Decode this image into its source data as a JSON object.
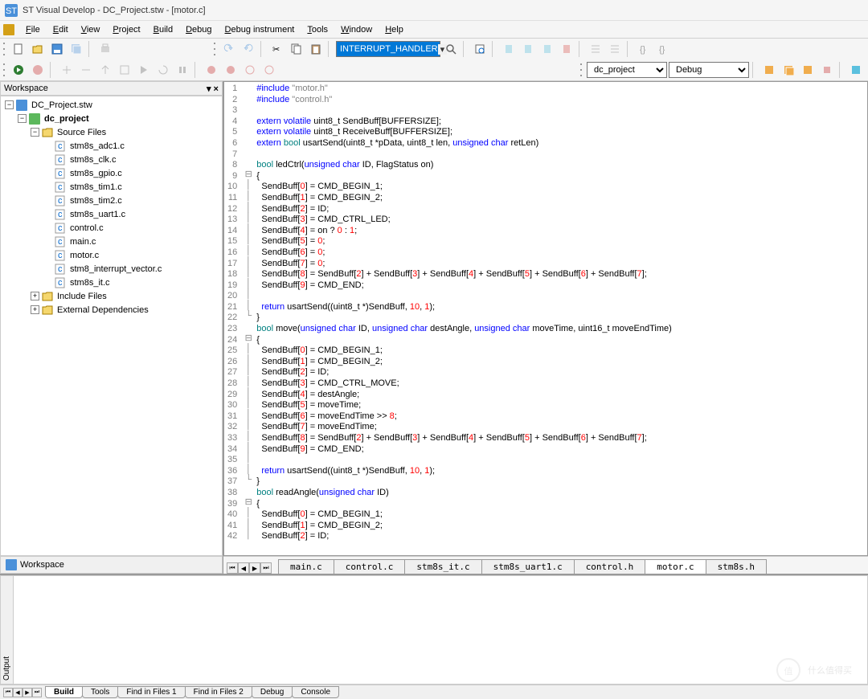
{
  "title": "ST Visual Develop - DC_Project.stw - [motor.c]",
  "menubar": [
    "File",
    "Edit",
    "View",
    "Project",
    "Build",
    "Debug",
    "Debug instrument",
    "Tools",
    "Window",
    "Help"
  ],
  "toolbar": {
    "highlight_text": "INTERRUPT_HANDLER",
    "target": "dc_project",
    "config": "Debug"
  },
  "workspace": {
    "title": "Workspace",
    "tab_label": "Workspace",
    "root": {
      "label": "DC_Project.stw",
      "icon": "workspace"
    },
    "project": {
      "label": "dc_project",
      "icon": "project"
    },
    "groups": [
      {
        "label": "Source Files",
        "expanded": true,
        "files": [
          "stm8s_adc1.c",
          "stm8s_clk.c",
          "stm8s_gpio.c",
          "stm8s_tim1.c",
          "stm8s_tim2.c",
          "stm8s_uart1.c",
          "control.c",
          "main.c",
          "motor.c",
          "stm8_interrupt_vector.c",
          "stm8s_it.c"
        ]
      },
      {
        "label": "Include Files",
        "expanded": false
      },
      {
        "label": "External Dependencies",
        "expanded": false
      }
    ]
  },
  "editor": {
    "active_tab": "motor.c",
    "tabs": [
      "main.c",
      "control.c",
      "stm8s_it.c",
      "stm8s_uart1.c",
      "control.h",
      "motor.c",
      "stm8s.h"
    ],
    "code_lines": [
      {
        "n": 1,
        "f": "",
        "t": [
          [
            "kw-blue",
            "#include "
          ],
          [
            "str",
            "\"motor.h\""
          ]
        ]
      },
      {
        "n": 2,
        "f": "",
        "t": [
          [
            "kw-blue",
            "#include "
          ],
          [
            "str",
            "\"control.h\""
          ]
        ]
      },
      {
        "n": 3,
        "f": "",
        "t": []
      },
      {
        "n": 4,
        "f": "",
        "t": [
          [
            "kw-blue",
            "extern"
          ],
          [
            "",
            " "
          ],
          [
            "kw-blue",
            "volatile"
          ],
          [
            "",
            " uint8_t SendBuff[BUFFERSIZE];"
          ]
        ]
      },
      {
        "n": 5,
        "f": "",
        "t": [
          [
            "kw-blue",
            "extern"
          ],
          [
            "",
            " "
          ],
          [
            "kw-blue",
            "volatile"
          ],
          [
            "",
            " uint8_t ReceiveBuff[BUFFERSIZE];"
          ]
        ]
      },
      {
        "n": 6,
        "f": "",
        "t": [
          [
            "kw-blue",
            "extern"
          ],
          [
            "",
            " "
          ],
          [
            "kw-green",
            "bool"
          ],
          [
            "",
            " usartSend(uint8_t *pData, uint8_t len, "
          ],
          [
            "kw-blue",
            "unsigned"
          ],
          [
            "",
            " "
          ],
          [
            "kw-blue",
            "char"
          ],
          [
            "",
            " retLen)"
          ]
        ]
      },
      {
        "n": 7,
        "f": "",
        "t": []
      },
      {
        "n": 8,
        "f": "",
        "t": [
          [
            "kw-green",
            "bool"
          ],
          [
            "",
            " ledCtrl("
          ],
          [
            "kw-blue",
            "unsigned"
          ],
          [
            "",
            " "
          ],
          [
            "kw-blue",
            "char"
          ],
          [
            "",
            " ID, FlagStatus on)"
          ]
        ]
      },
      {
        "n": 9,
        "f": "⊟",
        "t": [
          [
            "",
            "{"
          ]
        ]
      },
      {
        "n": 10,
        "f": "│",
        "t": [
          [
            "",
            "  SendBuff["
          ],
          [
            "num",
            "0"
          ],
          [
            "",
            "] = CMD_BEGIN_1;"
          ]
        ]
      },
      {
        "n": 11,
        "f": "│",
        "t": [
          [
            "",
            "  SendBuff["
          ],
          [
            "num",
            "1"
          ],
          [
            "",
            "] = CMD_BEGIN_2;"
          ]
        ]
      },
      {
        "n": 12,
        "f": "│",
        "t": [
          [
            "",
            "  SendBuff["
          ],
          [
            "num",
            "2"
          ],
          [
            "",
            "] = ID;"
          ]
        ]
      },
      {
        "n": 13,
        "f": "│",
        "t": [
          [
            "",
            "  SendBuff["
          ],
          [
            "num",
            "3"
          ],
          [
            "",
            "] = CMD_CTRL_LED;"
          ]
        ]
      },
      {
        "n": 14,
        "f": "│",
        "t": [
          [
            "",
            "  SendBuff["
          ],
          [
            "num",
            "4"
          ],
          [
            "",
            "] = on ? "
          ],
          [
            "num",
            "0"
          ],
          [
            "",
            " : "
          ],
          [
            "num",
            "1"
          ],
          [
            "",
            ";"
          ]
        ]
      },
      {
        "n": 15,
        "f": "│",
        "t": [
          [
            "",
            "  SendBuff["
          ],
          [
            "num",
            "5"
          ],
          [
            "",
            "] = "
          ],
          [
            "num",
            "0"
          ],
          [
            "",
            ";"
          ]
        ]
      },
      {
        "n": 16,
        "f": "│",
        "t": [
          [
            "",
            "  SendBuff["
          ],
          [
            "num",
            "6"
          ],
          [
            "",
            "] = "
          ],
          [
            "num",
            "0"
          ],
          [
            "",
            ";"
          ]
        ]
      },
      {
        "n": 17,
        "f": "│",
        "t": [
          [
            "",
            "  SendBuff["
          ],
          [
            "num",
            "7"
          ],
          [
            "",
            "] = "
          ],
          [
            "num",
            "0"
          ],
          [
            "",
            ";"
          ]
        ]
      },
      {
        "n": 18,
        "f": "│",
        "t": [
          [
            "",
            "  SendBuff["
          ],
          [
            "num",
            "8"
          ],
          [
            "",
            "] = SendBuff["
          ],
          [
            "num",
            "2"
          ],
          [
            "",
            "] + SendBuff["
          ],
          [
            "num",
            "3"
          ],
          [
            "",
            "] + SendBuff["
          ],
          [
            "num",
            "4"
          ],
          [
            "",
            "] + SendBuff["
          ],
          [
            "num",
            "5"
          ],
          [
            "",
            "] + SendBuff["
          ],
          [
            "num",
            "6"
          ],
          [
            "",
            "] + SendBuff["
          ],
          [
            "num",
            "7"
          ],
          [
            "",
            "];"
          ]
        ]
      },
      {
        "n": 19,
        "f": "│",
        "t": [
          [
            "",
            "  SendBuff["
          ],
          [
            "num",
            "9"
          ],
          [
            "",
            "] = CMD_END;"
          ]
        ]
      },
      {
        "n": 20,
        "f": "│",
        "t": []
      },
      {
        "n": 21,
        "f": "│",
        "t": [
          [
            "",
            "  "
          ],
          [
            "kw-blue",
            "return"
          ],
          [
            "",
            " usartSend((uint8_t *)SendBuff, "
          ],
          [
            "num",
            "10"
          ],
          [
            "",
            ", "
          ],
          [
            "num",
            "1"
          ],
          [
            "",
            ");"
          ]
        ]
      },
      {
        "n": 22,
        "f": "└",
        "t": [
          [
            "",
            "}"
          ]
        ]
      },
      {
        "n": 23,
        "f": "",
        "t": [
          [
            "kw-green",
            "bool"
          ],
          [
            "",
            " move("
          ],
          [
            "kw-blue",
            "unsigned"
          ],
          [
            "",
            " "
          ],
          [
            "kw-blue",
            "char"
          ],
          [
            "",
            " ID, "
          ],
          [
            "kw-blue",
            "unsigned"
          ],
          [
            "",
            " "
          ],
          [
            "kw-blue",
            "char"
          ],
          [
            "",
            " destAngle, "
          ],
          [
            "kw-blue",
            "unsigned"
          ],
          [
            "",
            " "
          ],
          [
            "kw-blue",
            "char"
          ],
          [
            "",
            " moveTime, uint16_t moveEndTime)"
          ]
        ]
      },
      {
        "n": 24,
        "f": "⊟",
        "t": [
          [
            "",
            "{"
          ]
        ]
      },
      {
        "n": 25,
        "f": "│",
        "t": [
          [
            "",
            "  SendBuff["
          ],
          [
            "num",
            "0"
          ],
          [
            "",
            "] = CMD_BEGIN_1;"
          ]
        ]
      },
      {
        "n": 26,
        "f": "│",
        "t": [
          [
            "",
            "  SendBuff["
          ],
          [
            "num",
            "1"
          ],
          [
            "",
            "] = CMD_BEGIN_2;"
          ]
        ]
      },
      {
        "n": 27,
        "f": "│",
        "t": [
          [
            "",
            "  SendBuff["
          ],
          [
            "num",
            "2"
          ],
          [
            "",
            "] = ID;"
          ]
        ]
      },
      {
        "n": 28,
        "f": "│",
        "t": [
          [
            "",
            "  SendBuff["
          ],
          [
            "num",
            "3"
          ],
          [
            "",
            "] = CMD_CTRL_MOVE;"
          ]
        ]
      },
      {
        "n": 29,
        "f": "│",
        "t": [
          [
            "",
            "  SendBuff["
          ],
          [
            "num",
            "4"
          ],
          [
            "",
            "] = destAngle;"
          ]
        ]
      },
      {
        "n": 30,
        "f": "│",
        "t": [
          [
            "",
            "  SendBuff["
          ],
          [
            "num",
            "5"
          ],
          [
            "",
            "] = moveTime;"
          ]
        ]
      },
      {
        "n": 31,
        "f": "│",
        "t": [
          [
            "",
            "  SendBuff["
          ],
          [
            "num",
            "6"
          ],
          [
            "",
            "] = moveEndTime >> "
          ],
          [
            "num",
            "8"
          ],
          [
            "",
            ";"
          ]
        ]
      },
      {
        "n": 32,
        "f": "│",
        "t": [
          [
            "",
            "  SendBuff["
          ],
          [
            "num",
            "7"
          ],
          [
            "",
            "] = moveEndTime;"
          ]
        ]
      },
      {
        "n": 33,
        "f": "│",
        "t": [
          [
            "",
            "  SendBuff["
          ],
          [
            "num",
            "8"
          ],
          [
            "",
            "] = SendBuff["
          ],
          [
            "num",
            "2"
          ],
          [
            "",
            "] + SendBuff["
          ],
          [
            "num",
            "3"
          ],
          [
            "",
            "] + SendBuff["
          ],
          [
            "num",
            "4"
          ],
          [
            "",
            "] + SendBuff["
          ],
          [
            "num",
            "5"
          ],
          [
            "",
            "] + SendBuff["
          ],
          [
            "num",
            "6"
          ],
          [
            "",
            "] + SendBuff["
          ],
          [
            "num",
            "7"
          ],
          [
            "",
            "];"
          ]
        ]
      },
      {
        "n": 34,
        "f": "│",
        "t": [
          [
            "",
            "  SendBuff["
          ],
          [
            "num",
            "9"
          ],
          [
            "",
            "] = CMD_END;"
          ]
        ]
      },
      {
        "n": 35,
        "f": "│",
        "t": []
      },
      {
        "n": 36,
        "f": "│",
        "t": [
          [
            "",
            "  "
          ],
          [
            "kw-blue",
            "return"
          ],
          [
            "",
            " usartSend((uint8_t *)SendBuff, "
          ],
          [
            "num",
            "10"
          ],
          [
            "",
            ", "
          ],
          [
            "num",
            "1"
          ],
          [
            "",
            ");"
          ]
        ]
      },
      {
        "n": 37,
        "f": "└",
        "t": [
          [
            "",
            "}"
          ]
        ]
      },
      {
        "n": 38,
        "f": "",
        "t": [
          [
            "kw-green",
            "bool"
          ],
          [
            "",
            " readAngle("
          ],
          [
            "kw-blue",
            "unsigned"
          ],
          [
            "",
            " "
          ],
          [
            "kw-blue",
            "char"
          ],
          [
            "",
            " ID)"
          ]
        ]
      },
      {
        "n": 39,
        "f": "⊟",
        "t": [
          [
            "",
            "{"
          ]
        ]
      },
      {
        "n": 40,
        "f": "│",
        "t": [
          [
            "",
            "  SendBuff["
          ],
          [
            "num",
            "0"
          ],
          [
            "",
            "] = CMD_BEGIN_1;"
          ]
        ]
      },
      {
        "n": 41,
        "f": "│",
        "t": [
          [
            "",
            "  SendBuff["
          ],
          [
            "num",
            "1"
          ],
          [
            "",
            "] = CMD_BEGIN_2;"
          ]
        ]
      },
      {
        "n": 42,
        "f": "│",
        "t": [
          [
            "",
            "  SendBuff["
          ],
          [
            "num",
            "2"
          ],
          [
            "",
            "] = ID;"
          ]
        ]
      }
    ]
  },
  "bottom": {
    "label": "Output",
    "tabs": [
      "Build",
      "Tools",
      "Find in Files 1",
      "Find in Files 2",
      "Debug",
      "Console"
    ],
    "active": "Build"
  },
  "watermark": "什么值得买"
}
